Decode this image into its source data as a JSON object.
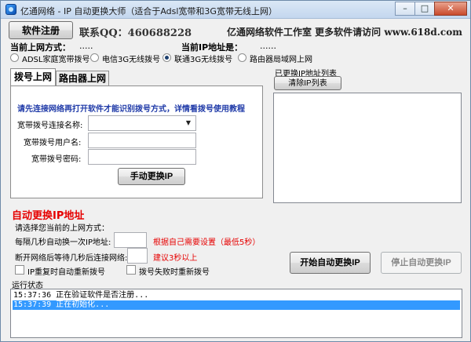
{
  "window": {
    "title": "亿通网络 - IP 自动更换大师（适合于Adsl宽带和3G宽带无线上网）",
    "minimize": "–",
    "maximize": "□",
    "close": "✕"
  },
  "header": {
    "register_button": "软件注册",
    "contact": "联系QQ：460688228",
    "promo": "亿通网络软件工作室 更多软件请访问 www.618d.com",
    "current_mode_label": "当前上网方式：",
    "current_mode_value": ".....",
    "current_ip_label": "当前IP地址是：",
    "current_ip_value": "......"
  },
  "modes": [
    {
      "label": "ADSL家庭宽带拨号",
      "checked": false
    },
    {
      "label": "电信3G无线拨号",
      "checked": false
    },
    {
      "label": "联通3G无线拨号",
      "checked": true
    },
    {
      "label": "路由器局域网上网",
      "checked": false
    }
  ],
  "tabs": [
    {
      "label": "拨号上网",
      "active": true
    },
    {
      "label": "路由器上网",
      "active": false
    }
  ],
  "dial": {
    "notice": "请先连接网络再打开软件才能识别拨号方式，详情看拨号使用教程",
    "conn_name_label": "宽带拨号连接名称:",
    "conn_name_value": "",
    "username_label": "宽带拨号用户名:",
    "username_value": "",
    "password_label": "宽带拨号密码:",
    "password_value": "",
    "manual_button": "手动更换IP"
  },
  "ip_list": {
    "label": "已更换IP地址列表",
    "clear_button": "清除IP列表",
    "items": []
  },
  "auto": {
    "title": "自动更换IP地址",
    "choose_mode": "请选择您当前的上网方式：",
    "interval_label": "每隔几秒自动换一次IP地址:",
    "interval_value": "",
    "interval_hint": "根据自己需要设置（最低5秒）",
    "reconnect_label": "断开网络后等待几秒后连接网络:",
    "reconnect_value": "",
    "reconnect_hint": "建议3秒以上",
    "check_ip_repeat": "IP重复时自动重新拨号",
    "check_dial_fail": "拨号失败时重新拨号",
    "start_button": "开始自动更换IP",
    "stop_button": "停止自动更换IP"
  },
  "status": {
    "label": "运行状态",
    "lines": [
      {
        "text": "15:37:36 正在验证软件是否注册...",
        "selected": false
      },
      {
        "text": "15:37:39 正在初始化...",
        "selected": true
      }
    ]
  },
  "colors": {
    "accent_red": "#e60000",
    "notice_blue": "#1f3aa8",
    "selection": "#3399ff"
  }
}
